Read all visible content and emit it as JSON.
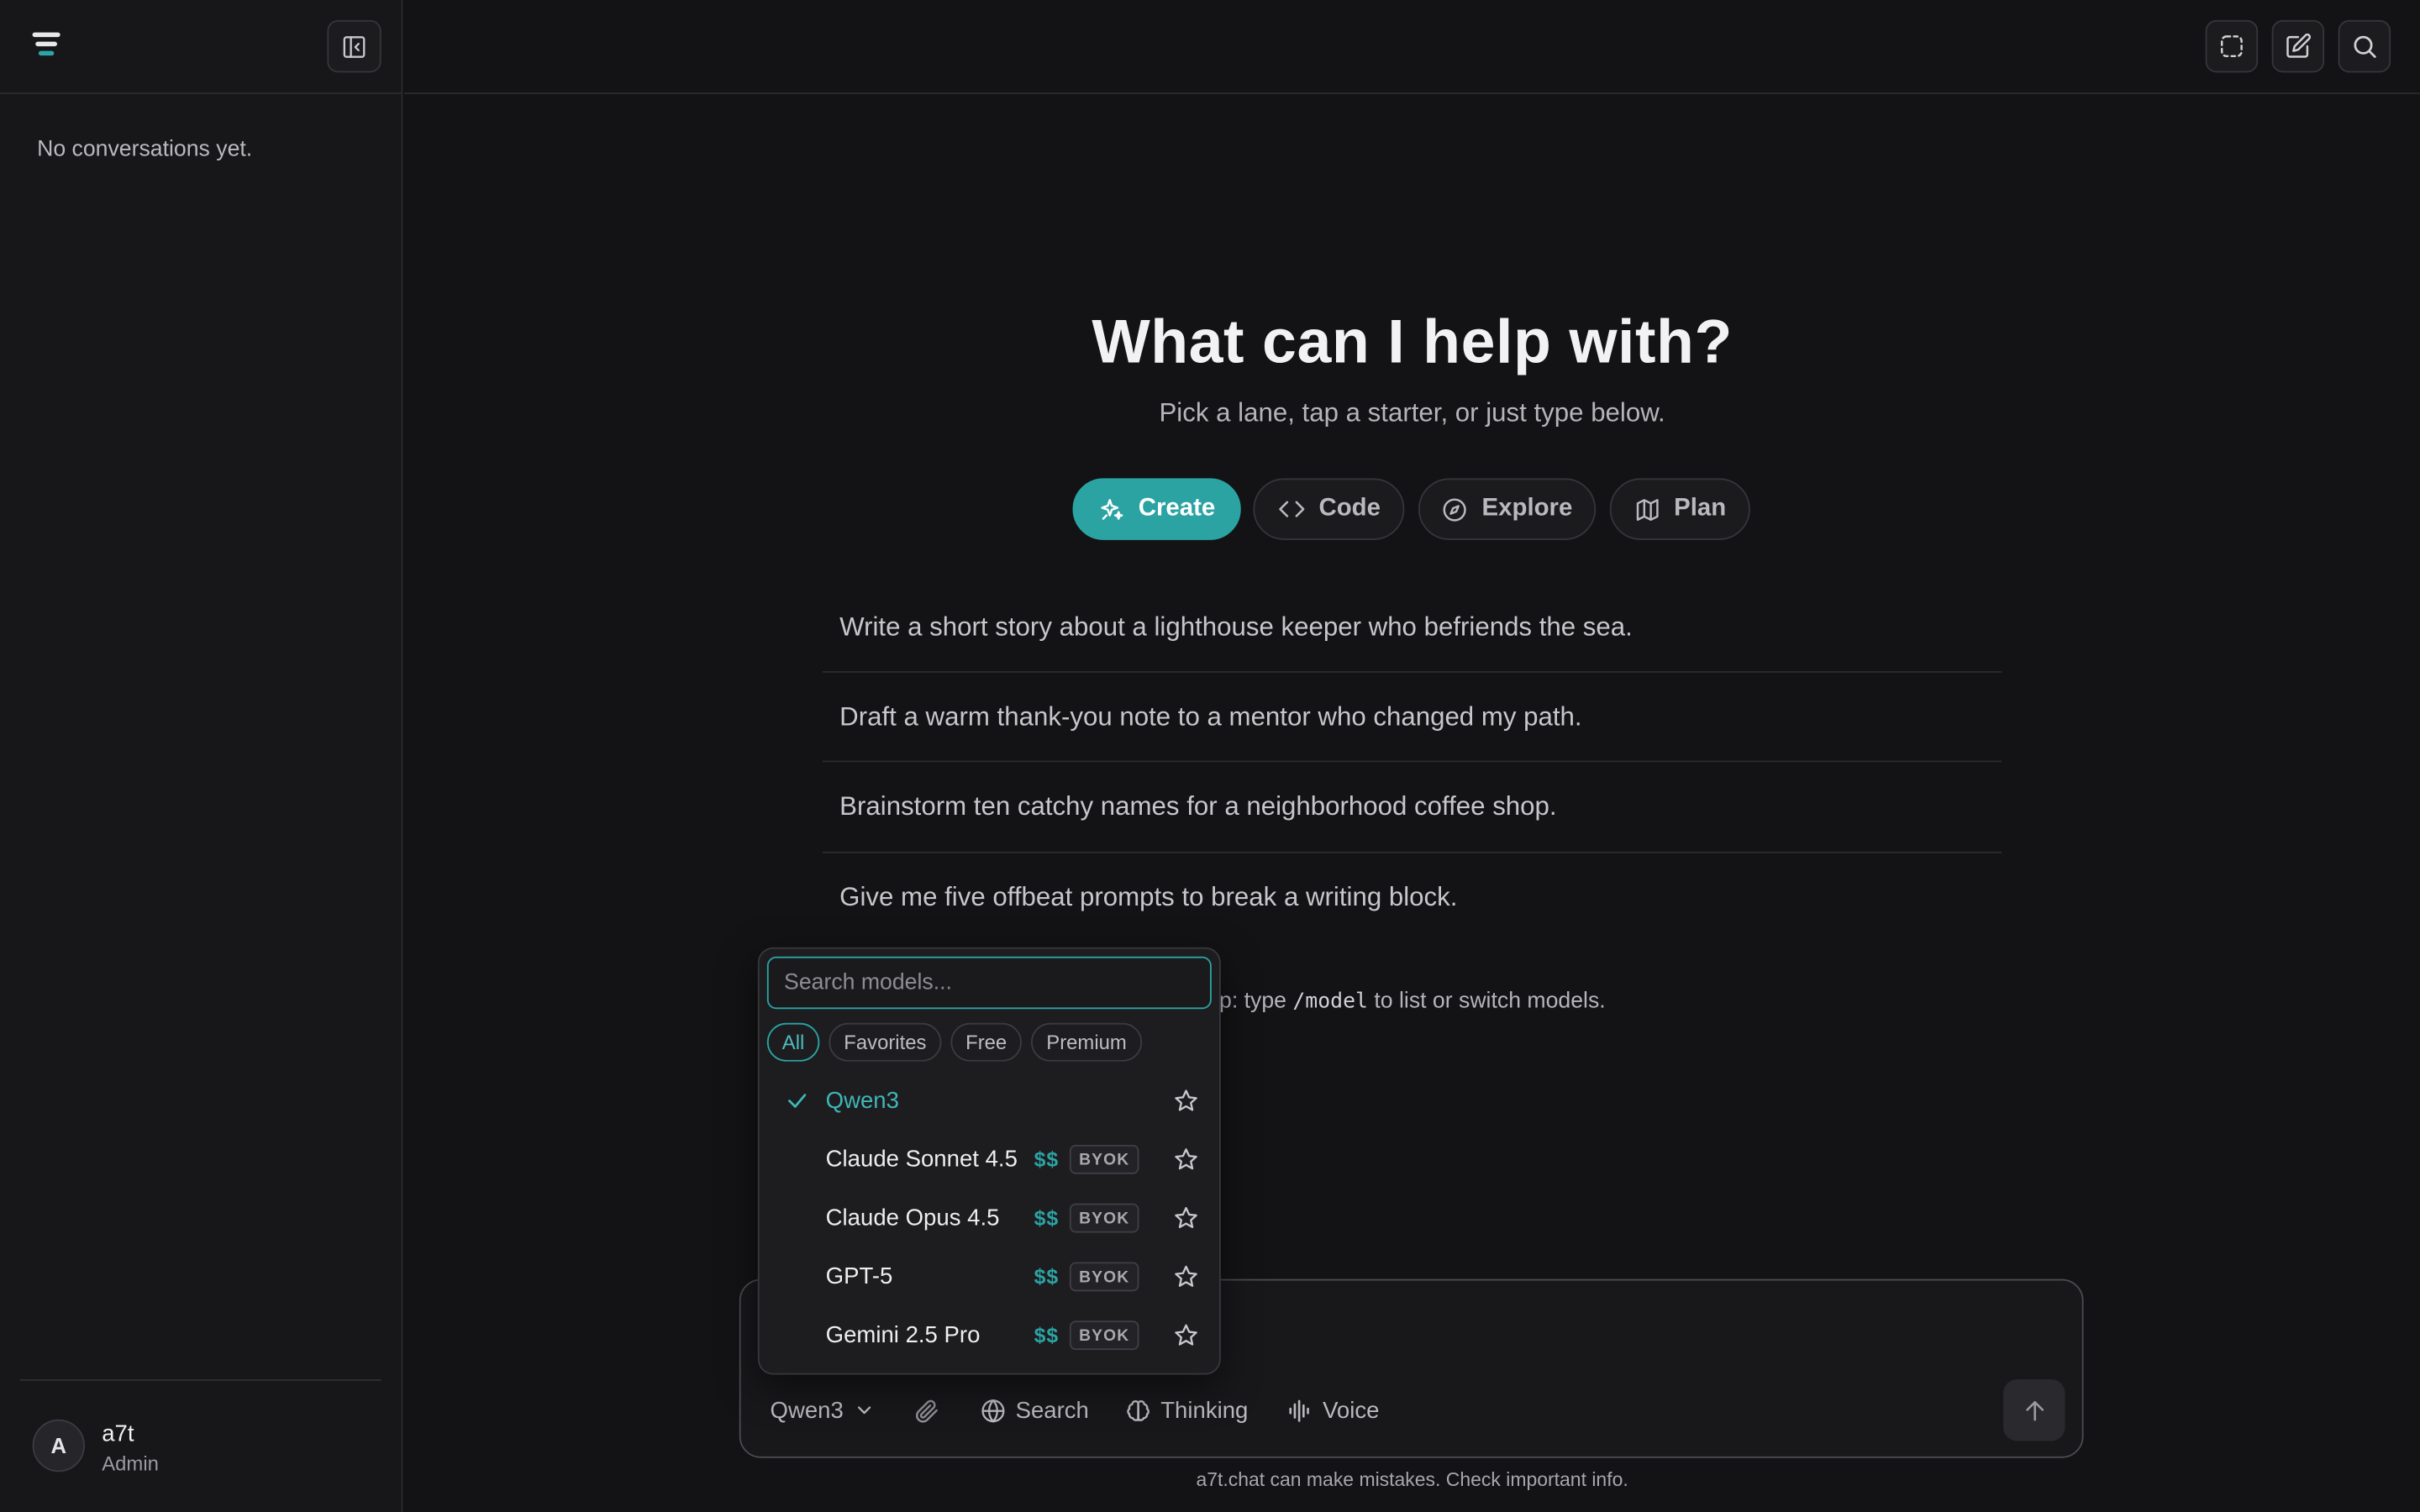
{
  "sidebar": {
    "empty_text": "No conversations yet.",
    "user": {
      "initial": "A",
      "name": "a7t",
      "role": "Admin"
    }
  },
  "hero": {
    "title": "What can I help with?",
    "subtitle": "Pick a lane, tap a starter, or just type below."
  },
  "lanes": [
    {
      "label": "Create",
      "icon": "sparkles-icon",
      "active": true
    },
    {
      "label": "Code",
      "icon": "code-icon",
      "active": false
    },
    {
      "label": "Explore",
      "icon": "compass-icon",
      "active": false
    },
    {
      "label": "Plan",
      "icon": "map-icon",
      "active": false
    }
  ],
  "starters": [
    "Write a short story about a lighthouse keeper who befriends the sea.",
    "Draft a warm thank-you note to a mentor who changed my path.",
    "Brainstorm ten catchy names for a neighborhood coffee shop.",
    "Give me five offbeat prompts to break a writing block."
  ],
  "tip": {
    "prefix": "p: type ",
    "command": "/model",
    "suffix": " to list or switch models."
  },
  "model_picker": {
    "search_placeholder": "Search models...",
    "filters": [
      "All",
      "Favorites",
      "Free",
      "Premium"
    ],
    "active_filter": "All",
    "models": [
      {
        "name": "Qwen3",
        "selected": true,
        "price": "",
        "badge": ""
      },
      {
        "name": "Claude Sonnet 4.5",
        "selected": false,
        "price": "$$",
        "badge": "BYOK"
      },
      {
        "name": "Claude Opus 4.5",
        "selected": false,
        "price": "$$",
        "badge": "BYOK"
      },
      {
        "name": "GPT-5",
        "selected": false,
        "price": "$$",
        "badge": "BYOK"
      },
      {
        "name": "Gemini 2.5 Pro",
        "selected": false,
        "price": "$$",
        "badge": "BYOK"
      }
    ]
  },
  "composer": {
    "model_label": "Qwen3",
    "search_label": "Search",
    "thinking_label": "Thinking",
    "voice_label": "Voice"
  },
  "disclaimer": "a7t.chat can make mistakes. Check important info.",
  "colors": {
    "accent": "#2ba3a3",
    "background": "#131315",
    "sidebar": "#171719"
  }
}
